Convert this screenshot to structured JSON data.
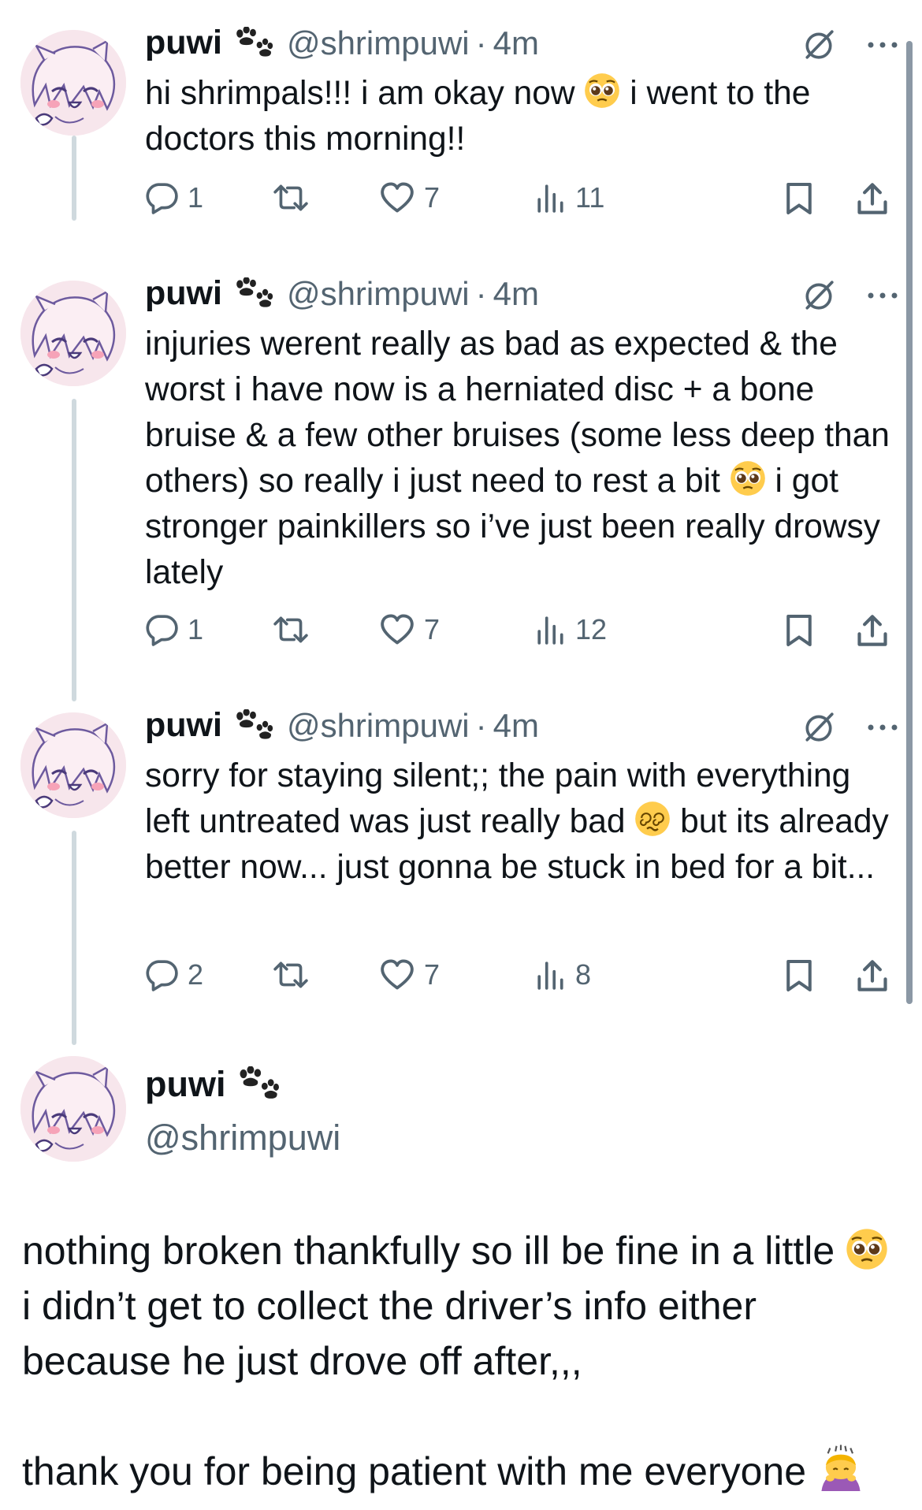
{
  "tweets": [
    {
      "name": "puwi",
      "handle": "@shrimpuwi",
      "time": "4m",
      "text_parts": [
        "hi shrimpals!!! i am okay now ",
        " i went to the doctors this morning!!"
      ],
      "emoji": "pleading-face",
      "replies": "1",
      "retweets": "",
      "likes": "7",
      "views": "11"
    },
    {
      "name": "puwi",
      "handle": "@shrimpuwi",
      "time": "4m",
      "text_parts": [
        "injuries werent really as bad as expected & the worst i have now is a herniated disc + a bone bruise & a few other bruises (some less deep than others) so really i just need to rest a bit ",
        " i got stronger painkillers so i’ve just been really drowsy lately"
      ],
      "emoji": "pleading-face",
      "replies": "1",
      "retweets": "",
      "likes": "7",
      "views": "12"
    },
    {
      "name": "puwi",
      "handle": "@shrimpuwi",
      "time": "4m",
      "text_parts": [
        "sorry for staying silent;; the pain with everything left untreated was just really bad ",
        " but its already better now... just gonna be stuck in bed for a bit..."
      ],
      "emoji": "dizzy-face",
      "replies": "2",
      "retweets": "",
      "likes": "7",
      "views": "8"
    }
  ],
  "main_tweet": {
    "name": "puwi",
    "handle": "@shrimpuwi",
    "text_parts": [
      "nothing broken thankfully so ill be fine in a little ",
      " i didn’t get to collect the driver’s info either because he just drove off after,,,\n\nthank you for being patient with me everyone "
    ],
    "emojis": [
      "pleading-face",
      "bowing-person"
    ]
  },
  "icons": {
    "reply": "reply-icon",
    "retweet": "retweet-icon",
    "like": "like-icon",
    "views": "views-icon",
    "bookmark": "bookmark-icon",
    "share": "share-icon",
    "grok": "grok-icon",
    "more": "more-icon",
    "paw": "paw-icon"
  },
  "colors": {
    "text": "#0f1419",
    "secondary": "#536471",
    "thread_line": "#cfd9de",
    "emoji_yellow": "#ffcc4d"
  }
}
